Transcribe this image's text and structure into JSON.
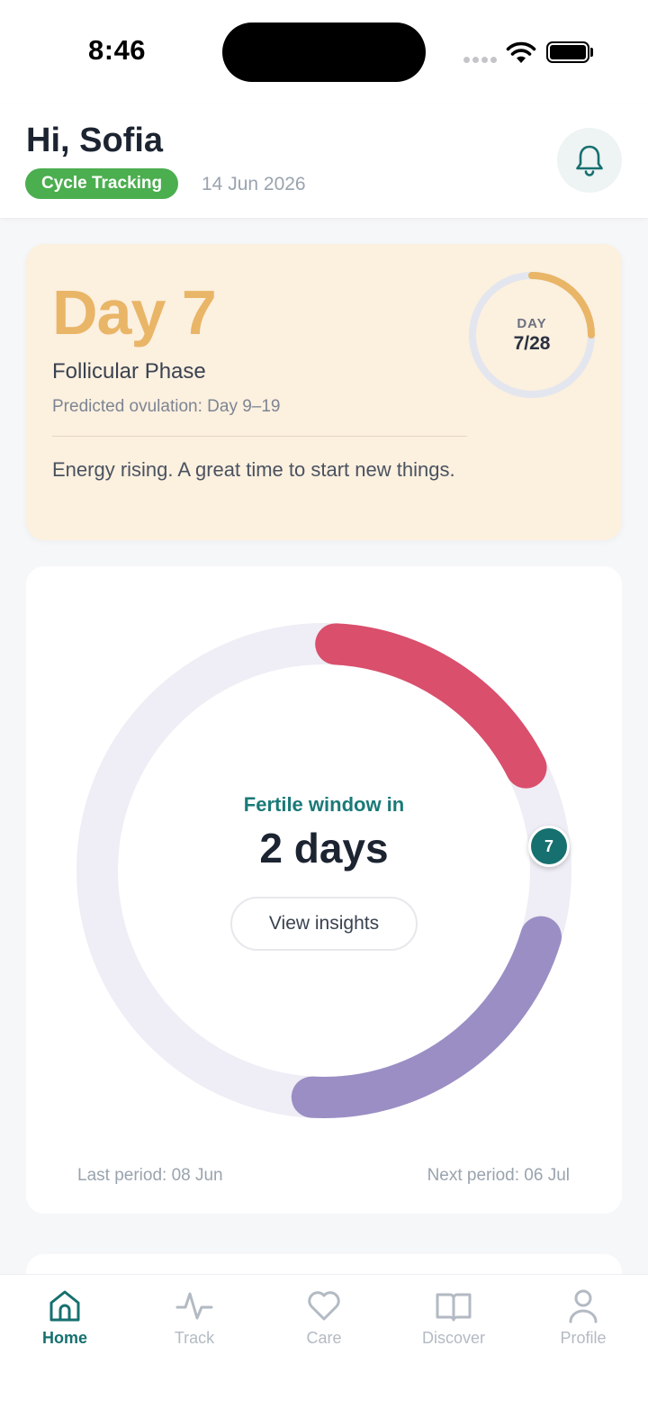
{
  "status_bar": {
    "time": "8:46"
  },
  "header": {
    "greeting": "Hi, Sofia",
    "mode_badge": "Cycle Tracking",
    "date": "14 Jun 2026",
    "bell_icon": "bell-icon"
  },
  "cycle_card": {
    "day_title": "Day 7",
    "phase": "Follicular Phase",
    "ovulation": "Predicted ovulation: Day 9–19",
    "energy": "Energy rising. A great time to start new things.",
    "ring_label": "DAY",
    "ring_value": "7/28",
    "current_day": 7,
    "cycle_length": 28,
    "accent_color": "#e9b567"
  },
  "cycle_wheel": {
    "fertile_label": "Fertile window in",
    "fertile_value": "2 days",
    "insights_button": "View insights",
    "marker_day": "7",
    "last_period": "Last period: 08 Jun",
    "next_period": "Next period: 06 Jul",
    "period_color": "#d94f6c",
    "fertile_color": "#9b8ec4",
    "track_color": "#efedf5",
    "marker_color": "#16706f"
  },
  "tab_bar": {
    "items": [
      {
        "label": "Home",
        "icon": "home-icon",
        "active": true
      },
      {
        "label": "Track",
        "icon": "pulse-icon",
        "active": false
      },
      {
        "label": "Care",
        "icon": "heart-icon",
        "active": false
      },
      {
        "label": "Discover",
        "icon": "book-icon",
        "active": false
      },
      {
        "label": "Profile",
        "icon": "person-icon",
        "active": false
      }
    ]
  }
}
